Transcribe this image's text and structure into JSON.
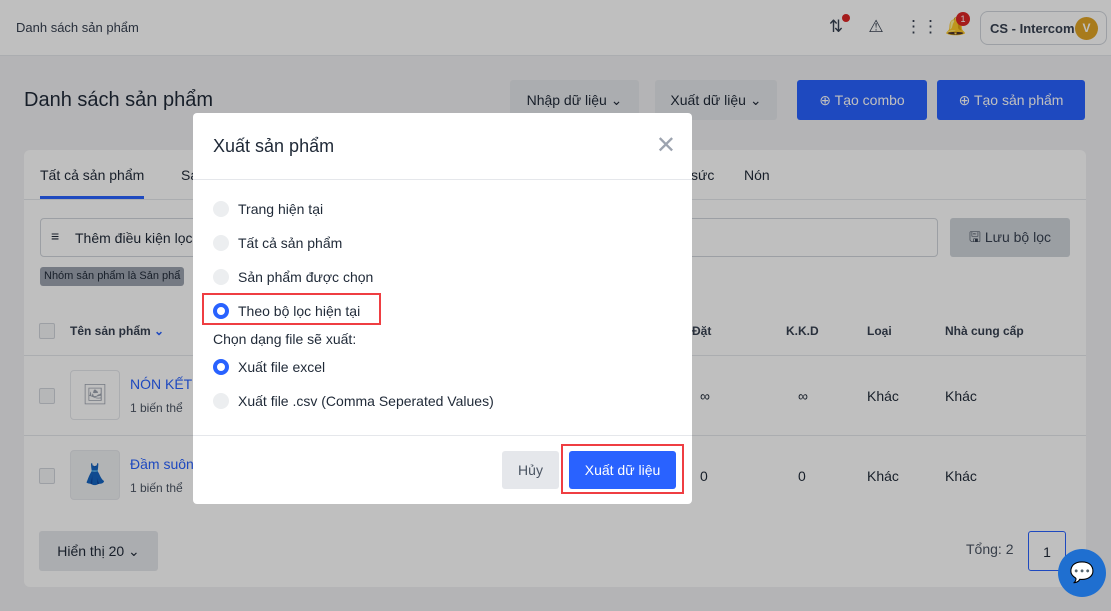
{
  "topbar": {
    "breadcrumb": "Danh sách sản phẩm",
    "account": "CS - Intercom",
    "avatar": "V",
    "notif_count": "1"
  },
  "page": {
    "title": "Danh sách sản phẩm",
    "import": "Nhập dữ liệu",
    "export": "Xuất dữ liệu",
    "combo": "Tạo combo",
    "create": "Tạo sản phẩm"
  },
  "tabs": [
    "Tất cả sản phẩm",
    "Sa",
    "sức",
    "Nón"
  ],
  "filter": {
    "placeholder": "Thêm điều kiện lọc",
    "save": "Lưu bộ lọc",
    "chip": "Nhóm sản phẩm là Sản phẩ"
  },
  "table": {
    "headers": [
      "Tên sản phẩm",
      "Đặt",
      "K.K.D",
      "Loại",
      "Nhà cung cấp"
    ],
    "rows": [
      {
        "name": "NÓN KẾT",
        "variants": "1 biến thể",
        "dat": "∞",
        "kkd": "∞",
        "loai": "Khác",
        "ncc": "Khác"
      },
      {
        "name": "Đầm suôn",
        "variants": "1 biến thể",
        "dat": "0",
        "kkd": "0",
        "loai": "Khác",
        "ncc": "Khác"
      }
    ]
  },
  "footer": {
    "page_size": "Hiển thị 20",
    "total": "Tổng: 2",
    "page": "1"
  },
  "modal": {
    "title": "Xuất sản phẩm",
    "options": [
      "Trang hiện tại",
      "Tất cả sản phẩm",
      "Sản phẩm được chọn",
      "Theo bộ lọc hiện tại"
    ],
    "format_label": "Chọn dạng file sẽ xuất:",
    "formats": [
      "Xuất file excel",
      "Xuất file .csv (Comma Seperated Values)"
    ],
    "cancel": "Hủy",
    "submit": "Xuất dữ liệu"
  }
}
